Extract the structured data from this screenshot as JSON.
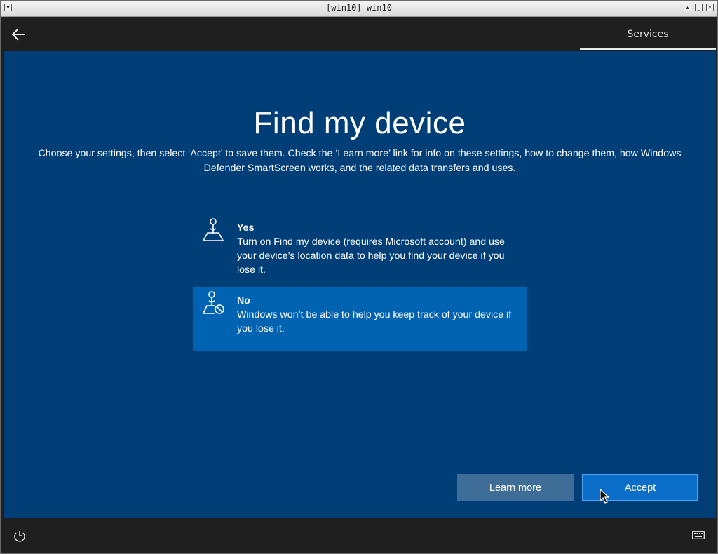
{
  "window": {
    "title": "[win10] win10"
  },
  "header": {
    "back_icon": "arrow-left-icon",
    "tab_label": "Services"
  },
  "page": {
    "title": "Find my device",
    "subtitle": "Choose your settings, then select ‘Accept’ to save them. Check the ‘Learn more’ link for info on these settings, how to change them, how Windows Defender SmartScreen works, and the related data transfers and uses."
  },
  "options": [
    {
      "title": "Yes",
      "description": "Turn on Find my device (requires Microsoft account) and use your device’s location data to help you find your device if you lose it.",
      "icon": "location-person-icon",
      "selected": false
    },
    {
      "title": "No",
      "description": "Windows won’t be able to help you keep track of your device if you lose it.",
      "icon": "location-person-blocked-icon",
      "selected": true
    }
  ],
  "buttons": {
    "learn_more": "Learn more",
    "accept": "Accept"
  },
  "footer": {
    "ease_icon": "ease-of-access-icon",
    "keyboard_icon": "keyboard-icon"
  },
  "colors": {
    "background": "#003e77",
    "selected_option": "#0063b1",
    "accept_button": "#0a6dc7",
    "learn_more_button": "#3e6e97",
    "chrome": "#1f1f1f"
  }
}
